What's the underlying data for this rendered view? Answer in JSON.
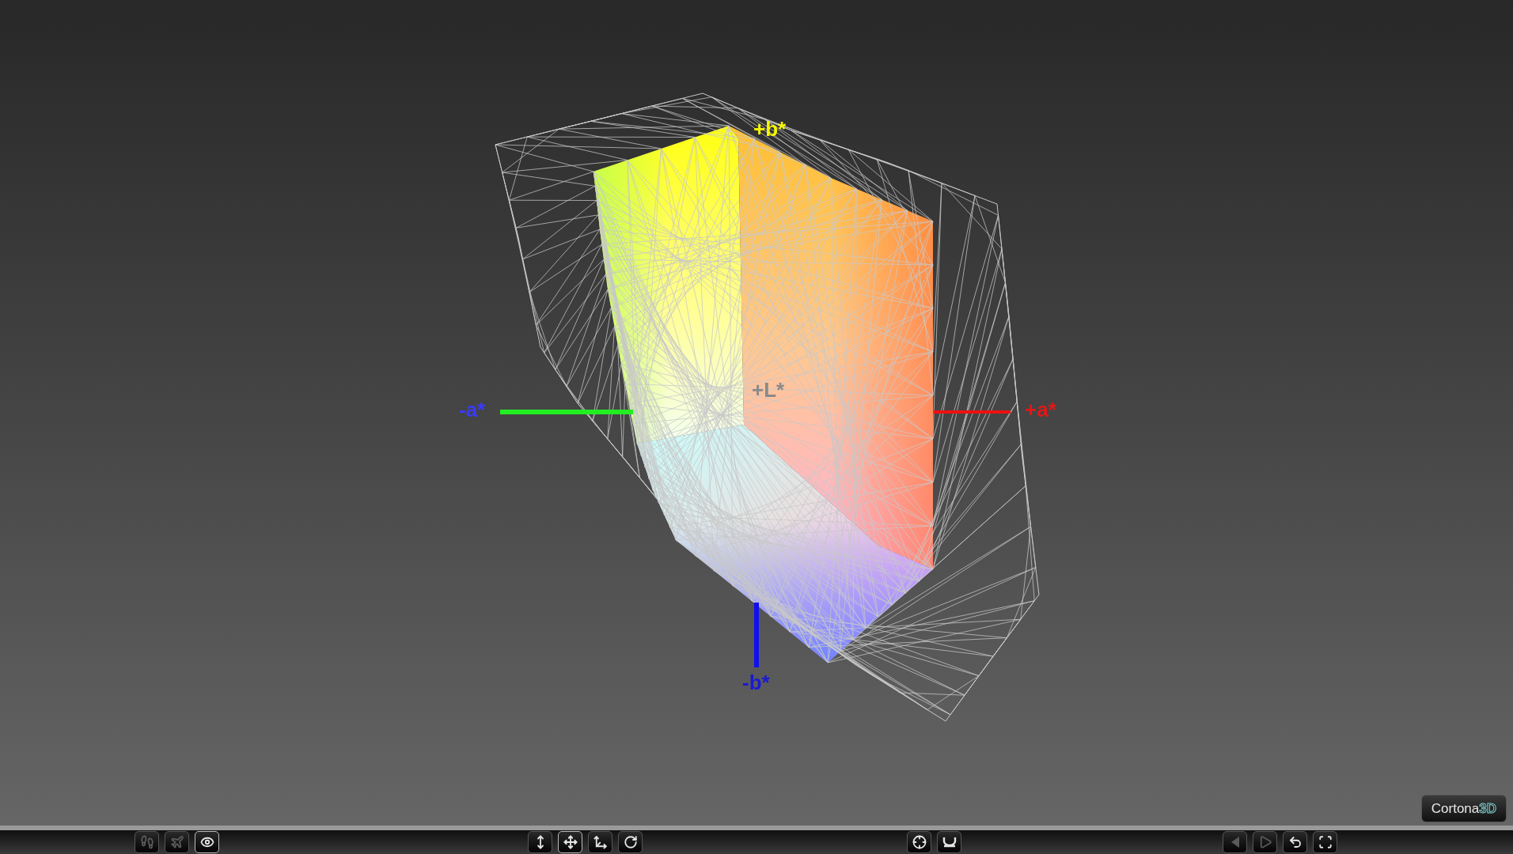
{
  "viewport": {
    "axis_labels": [
      {
        "text": "+b*",
        "color": "#f5f500"
      },
      {
        "text": "-a*",
        "color": "#3a3aff"
      },
      {
        "text": "+L*",
        "color": "#8a8a8a"
      },
      {
        "text": "+a*",
        "color": "#e01818"
      },
      {
        "text": "-b*",
        "color": "#1a1ad0"
      }
    ]
  },
  "logo": {
    "name": "Cortona",
    "suffix": "3D"
  },
  "toolbar": {
    "groups": [
      {
        "buttons": [
          {
            "disabled": true,
            "selected": false
          },
          {
            "disabled": true,
            "selected": false
          },
          {
            "disabled": false,
            "selected": true
          }
        ]
      },
      {
        "buttons": [
          {
            "disabled": false,
            "selected": false
          },
          {
            "disabled": false,
            "selected": true
          },
          {
            "disabled": false,
            "selected": false
          },
          {
            "disabled": false,
            "selected": false
          }
        ]
      },
      {
        "buttons": [
          {
            "disabled": false,
            "selected": false
          },
          {
            "disabled": false,
            "selected": false
          }
        ]
      },
      {
        "buttons": [
          {
            "disabled": true,
            "selected": false
          },
          {
            "disabled": true,
            "selected": false
          },
          {
            "disabled": false,
            "selected": false
          },
          {
            "disabled": false,
            "selected": false
          }
        ]
      }
    ]
  }
}
